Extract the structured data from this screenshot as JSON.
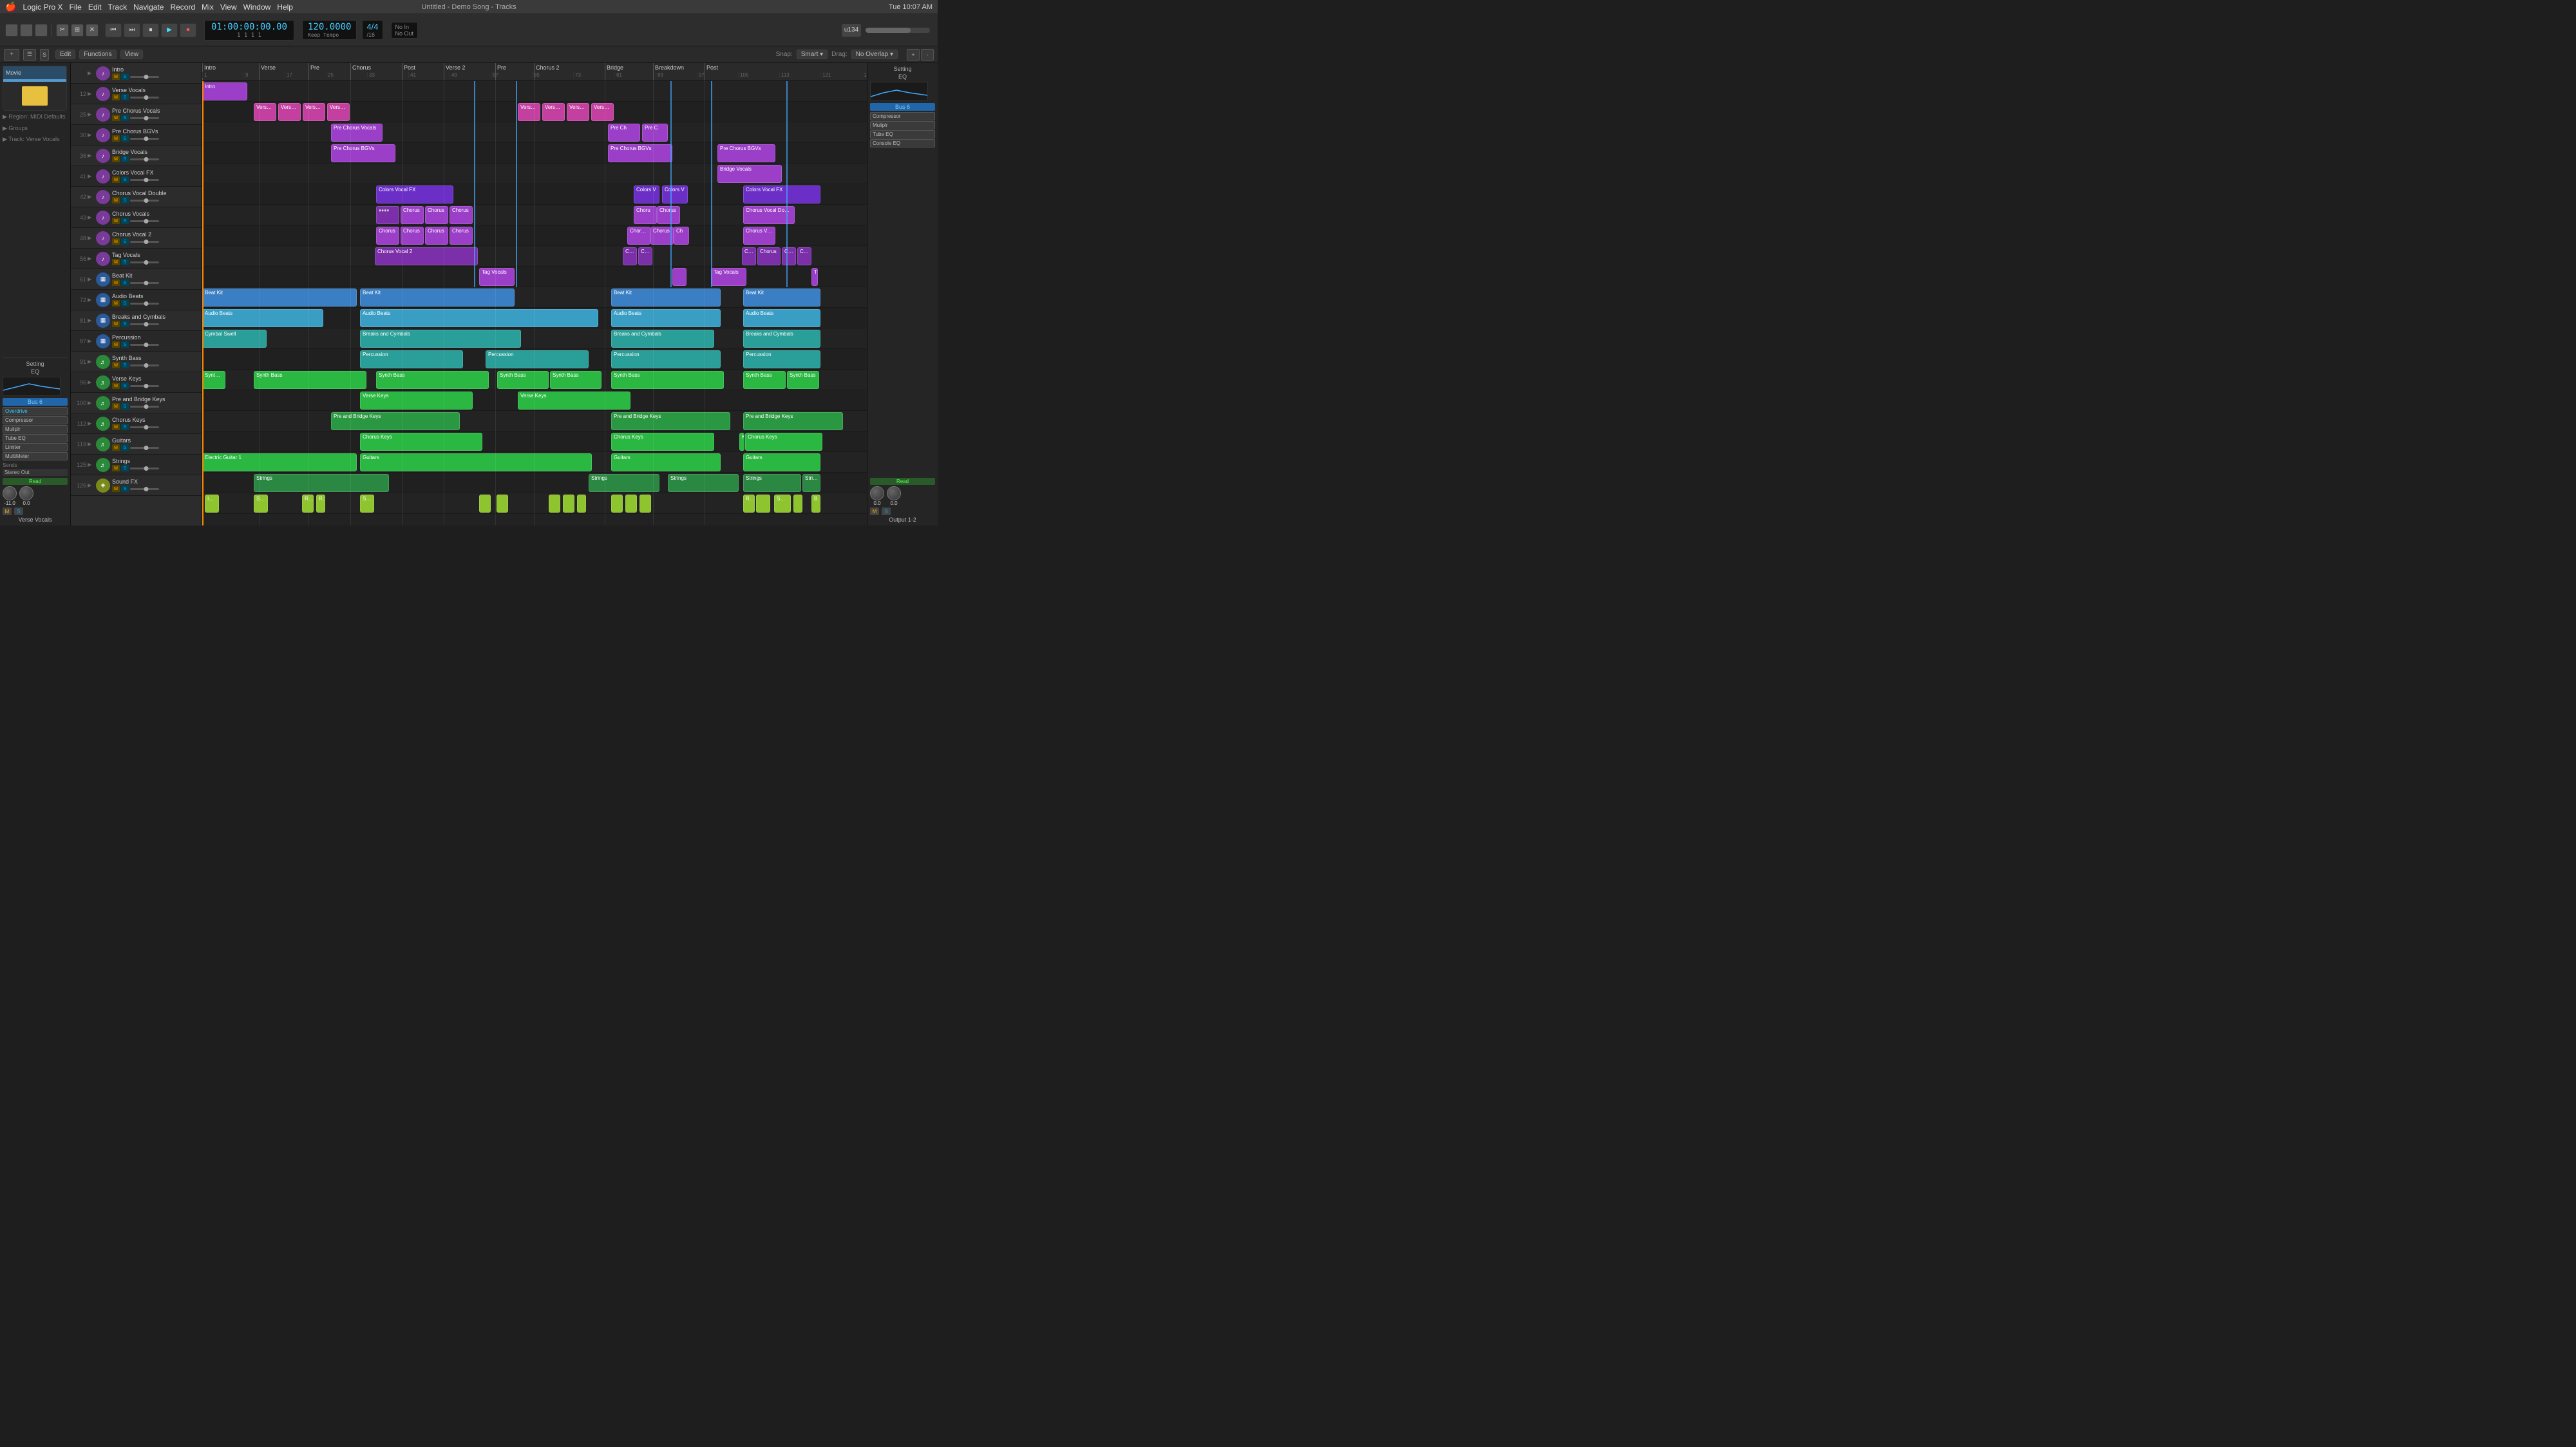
{
  "app": {
    "title": "Logic Pro X",
    "window_title": "Untitled - Demo Song - Tracks",
    "os_time": "Tue 10:07 AM"
  },
  "menu": {
    "apple": "⌘",
    "items": [
      "Logic Pro X",
      "File",
      "Edit",
      "Track",
      "Navigate",
      "Record",
      "Mix",
      "View",
      "Window",
      "Help"
    ]
  },
  "transport": {
    "position": "01:00:00:00.00",
    "bar_beat": "1  1  1  1",
    "bpm": "120.0000",
    "time_sig": "4/4",
    "division": "/16",
    "in_point": "No In",
    "out_point": "No Out",
    "rewind_label": "⏪",
    "fast_forward_label": "⏩",
    "stop_label": "⏹",
    "play_label": "▶",
    "record_label": "⏺",
    "keep_tempo_label": "Keep Tempo"
  },
  "toolbar2": {
    "edit_label": "Edit",
    "functions_label": "Functions",
    "view_label": "View",
    "snap_label": "Snap: Smart",
    "drag_label": "Drag: No Overlap"
  },
  "inspector": {
    "region_label": "Region:",
    "region_value": "MIDI Defaults",
    "groups_label": "Groups",
    "track_label": "Track:",
    "track_value": "Verse Vocals"
  },
  "left_channel": {
    "setting_label": "Setting",
    "eq_label": "EQ",
    "bus_label": "Bus 6",
    "plugins": [
      "Overdrive",
      "Compressor",
      "Muliplr",
      "Tube EQ",
      "Limiter",
      "MultiMeter"
    ],
    "sends_label": "Sends",
    "stereo_out_label": "Stereo Out",
    "read_label": "Read",
    "volume_db": "-11.0",
    "pan_db": "0.0",
    "channel_name": "Verse Vocals"
  },
  "right_channel": {
    "setting_label": "Setting",
    "eq_label": "EQ",
    "bus_label": "Bus 6",
    "plugins": [
      "Compressor",
      "Muliplr",
      "Tube EQ",
      "Console EQ"
    ],
    "sends_label": "",
    "stereo_out_label": "",
    "read_label": "Read",
    "volume_db": "0.0",
    "channel_name": "Output 1-2"
  },
  "tracks": [
    {
      "number": "",
      "name": "Intro",
      "color": "purple",
      "icon": "♪",
      "type": "vocal"
    },
    {
      "number": "12",
      "name": "Verse Vocals",
      "color": "purple",
      "icon": "♪",
      "type": "vocal"
    },
    {
      "number": "25",
      "name": "Pre Chorus Vocals",
      "color": "purple",
      "icon": "♪",
      "type": "vocal"
    },
    {
      "number": "30",
      "name": "Pre Chorus BGVs",
      "color": "purple",
      "icon": "♪",
      "type": "vocal"
    },
    {
      "number": "36",
      "name": "Bridge Vocals",
      "color": "purple",
      "icon": "♪",
      "type": "vocal"
    },
    {
      "number": "41",
      "name": "Colors Vocal FX",
      "color": "purple",
      "icon": "♪",
      "type": "vocal"
    },
    {
      "number": "42",
      "name": "Chorus Vocal Double",
      "color": "purple",
      "icon": "♪",
      "type": "vocal"
    },
    {
      "number": "43",
      "name": "Chorus Vocals",
      "color": "purple",
      "icon": "♪",
      "type": "vocal"
    },
    {
      "number": "48",
      "name": "Chorus Vocal 2",
      "color": "purple",
      "icon": "♪",
      "type": "vocal"
    },
    {
      "number": "56",
      "name": "Tag Vocals",
      "color": "purple",
      "icon": "♪",
      "type": "vocal"
    },
    {
      "number": "61",
      "name": "Beat Kit",
      "color": "blue",
      "icon": "▦",
      "type": "beat"
    },
    {
      "number": "72",
      "name": "Audio Beats",
      "color": "blue",
      "icon": "▦",
      "type": "beat"
    },
    {
      "number": "81",
      "name": "Breaks and Cymbals",
      "color": "teal",
      "icon": "▦",
      "type": "beat"
    },
    {
      "number": "87",
      "name": "Percussion",
      "color": "teal",
      "icon": "▦",
      "type": "beat"
    },
    {
      "number": "91",
      "name": "Synth Bass",
      "color": "green",
      "icon": "♬",
      "type": "synth"
    },
    {
      "number": "96",
      "name": "Verse Keys",
      "color": "green",
      "icon": "♬",
      "type": "synth"
    },
    {
      "number": "100",
      "name": "Pre and Bridge Keys",
      "color": "green",
      "icon": "♬",
      "type": "synth"
    },
    {
      "number": "112",
      "name": "Chorus Keys",
      "color": "green",
      "icon": "♬",
      "type": "synth"
    },
    {
      "number": "119",
      "name": "Guitars",
      "color": "green",
      "icon": "♬",
      "type": "synth"
    },
    {
      "number": "125",
      "name": "Strings",
      "color": "green",
      "icon": "♬",
      "type": "synth"
    },
    {
      "number": "126",
      "name": "Sound FX",
      "color": "yellow-green",
      "icon": "◈",
      "type": "fx"
    }
  ],
  "sections": [
    {
      "label": "Intro",
      "position": 0
    },
    {
      "label": "Verse",
      "position": 88
    },
    {
      "label": "Pre",
      "position": 165
    },
    {
      "label": "Chorus",
      "position": 230
    },
    {
      "label": "Post",
      "position": 310
    },
    {
      "label": "Verse 2",
      "position": 375
    },
    {
      "label": "Pre",
      "position": 455
    },
    {
      "label": "Chorus 2",
      "position": 515
    },
    {
      "label": "Bridge",
      "position": 625
    },
    {
      "label": "Breakdown",
      "position": 700
    },
    {
      "label": "Post",
      "position": 780
    }
  ],
  "colors": {
    "purple_region": "#9b3fc8",
    "pink_region": "#c4408a",
    "blue_region": "#3a7ec4",
    "teal_region": "#2a9e98",
    "green_region": "#2aba44",
    "yellow_green": "#8ec42e",
    "dark_bg": "#222222",
    "track_bg": "#2c2c2c",
    "ruler_bg": "#2a2a2a"
  }
}
